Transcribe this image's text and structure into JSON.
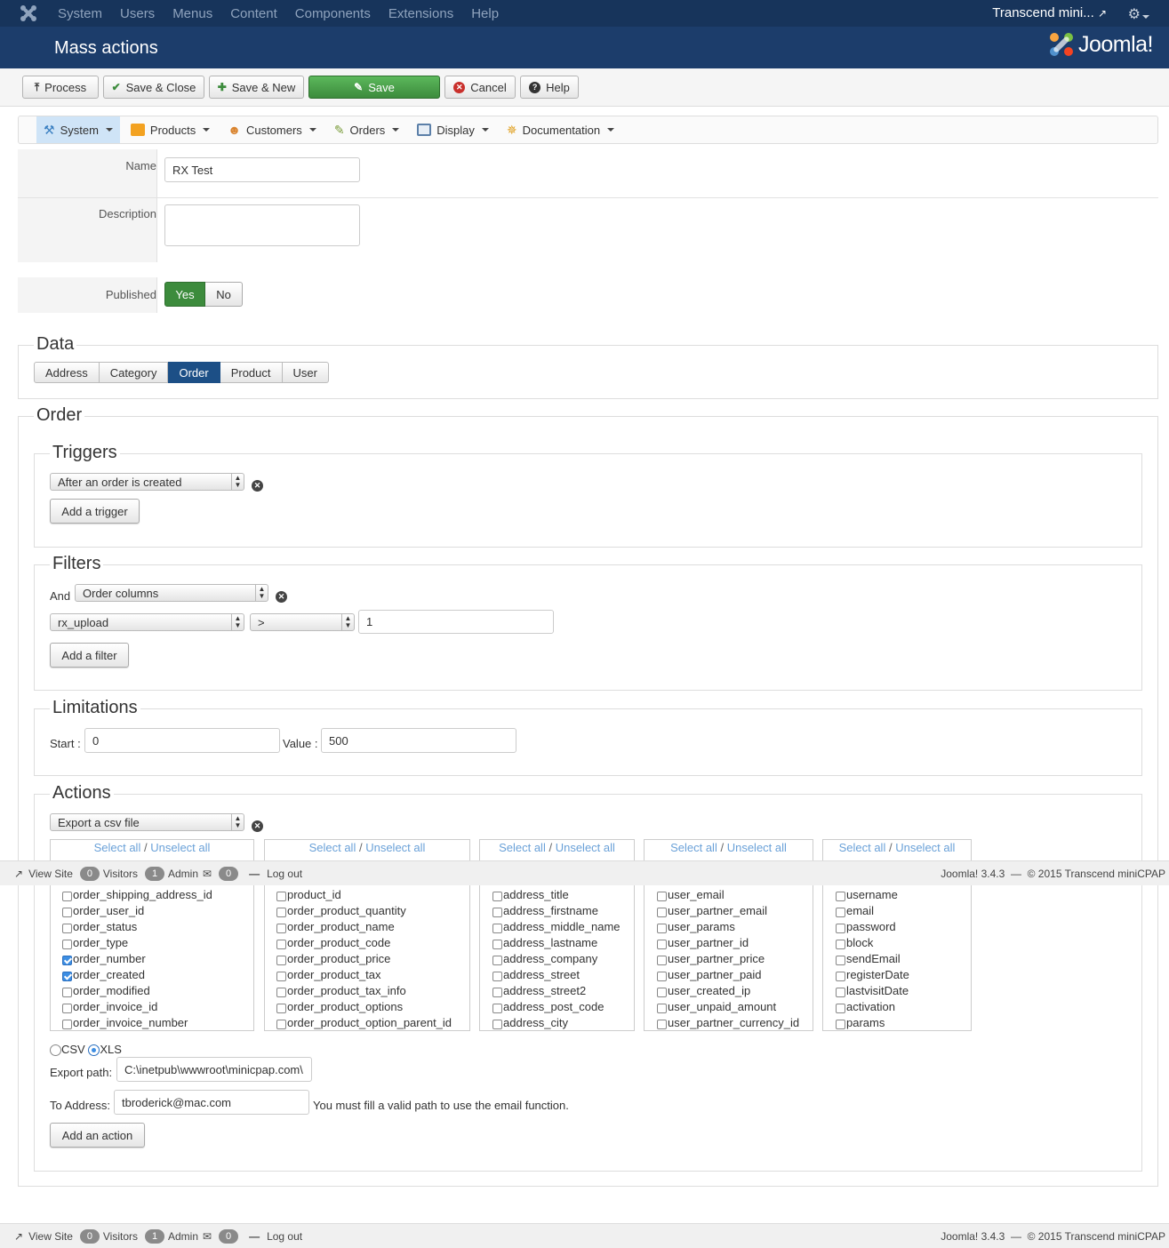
{
  "topnav": {
    "menu": [
      "System",
      "Users",
      "Menus",
      "Content",
      "Components",
      "Extensions",
      "Help"
    ],
    "site_name": "Transcend mini...",
    "icons": [
      "joomla-icon",
      "external-link-icon",
      "gear-icon"
    ]
  },
  "header": {
    "title": "Mass actions",
    "brand": "Joomla!"
  },
  "toolbar": {
    "process": "Process",
    "save_close": "Save & Close",
    "save_new": "Save & New",
    "save": "Save",
    "cancel": "Cancel",
    "help": "Help"
  },
  "submenu": {
    "items": [
      "System",
      "Products",
      "Customers",
      "Orders",
      "Display",
      "Documentation"
    ]
  },
  "form": {
    "name_label": "Name",
    "name_value": "RX Test",
    "description_label": "Description",
    "description_value": "",
    "published_label": "Published",
    "yes": "Yes",
    "no": "No"
  },
  "data_section": {
    "legend": "Data",
    "tabs": [
      "Address",
      "Category",
      "Order",
      "Product",
      "User"
    ],
    "active_tab": "Order"
  },
  "order_section": {
    "legend": "Order",
    "triggers": {
      "legend": "Triggers",
      "selected": "After an order is created",
      "add_button": "Add a trigger"
    },
    "filters": {
      "legend": "Filters",
      "and_label": "And",
      "type_selected": "Order columns",
      "column_selected": "rx_upload",
      "operator_selected": ">",
      "value": "1",
      "add_button": "Add a filter"
    },
    "limitations": {
      "legend": "Limitations",
      "start_label": "Start :",
      "start_value": "0",
      "value_label": "Value :",
      "value_value": "500"
    },
    "actions": {
      "legend": "Actions",
      "selected": "Export a csv file",
      "select_all": "Select all",
      "separator": "/",
      "unselect_all": "Unselect all",
      "columns": [
        {
          "items": [
            {
              "label": "order_shipping_address_id",
              "checked": false
            },
            {
              "label": "order_user_id",
              "checked": false
            },
            {
              "label": "order_status",
              "checked": false
            },
            {
              "label": "order_type",
              "checked": false
            },
            {
              "label": "order_number",
              "checked": true
            },
            {
              "label": "order_created",
              "checked": true
            },
            {
              "label": "order_modified",
              "checked": false
            },
            {
              "label": "order_invoice_id",
              "checked": false
            },
            {
              "label": "order_invoice_number",
              "checked": false
            }
          ]
        },
        {
          "items": [
            {
              "label": "product_id",
              "checked": false
            },
            {
              "label": "order_product_quantity",
              "checked": false
            },
            {
              "label": "order_product_name",
              "checked": false
            },
            {
              "label": "order_product_code",
              "checked": false
            },
            {
              "label": "order_product_price",
              "checked": false
            },
            {
              "label": "order_product_tax",
              "checked": false
            },
            {
              "label": "order_product_tax_info",
              "checked": false
            },
            {
              "label": "order_product_options",
              "checked": false
            },
            {
              "label": "order_product_option_parent_id",
              "checked": false
            }
          ]
        },
        {
          "items": [
            {
              "label": "address_title",
              "checked": false
            },
            {
              "label": "address_firstname",
              "checked": false
            },
            {
              "label": "address_middle_name",
              "checked": false
            },
            {
              "label": "address_lastname",
              "checked": false
            },
            {
              "label": "address_company",
              "checked": false
            },
            {
              "label": "address_street",
              "checked": false
            },
            {
              "label": "address_street2",
              "checked": false
            },
            {
              "label": "address_post_code",
              "checked": false
            },
            {
              "label": "address_city",
              "checked": false
            }
          ]
        },
        {
          "items": [
            {
              "label": "user_email",
              "checked": false
            },
            {
              "label": "user_partner_email",
              "checked": false
            },
            {
              "label": "user_params",
              "checked": false
            },
            {
              "label": "user_partner_id",
              "checked": false
            },
            {
              "label": "user_partner_price",
              "checked": false
            },
            {
              "label": "user_partner_paid",
              "checked": false
            },
            {
              "label": "user_created_ip",
              "checked": false
            },
            {
              "label": "user_unpaid_amount",
              "checked": false
            },
            {
              "label": "user_partner_currency_id",
              "checked": false
            }
          ]
        },
        {
          "items": [
            {
              "label": "username",
              "checked": false
            },
            {
              "label": "email",
              "checked": false
            },
            {
              "label": "password",
              "checked": false
            },
            {
              "label": "block",
              "checked": false
            },
            {
              "label": "sendEmail",
              "checked": false
            },
            {
              "label": "registerDate",
              "checked": false
            },
            {
              "label": "lastvisitDate",
              "checked": false
            },
            {
              "label": "activation",
              "checked": false
            },
            {
              "label": "params",
              "checked": false
            }
          ]
        }
      ],
      "format_csv": "CSV",
      "format_xls": "XLS",
      "format_selected": "XLS",
      "export_path_label": "Export path:",
      "export_path_value": "C:\\inetpub\\wwwroot\\minicpap.com\\",
      "to_address_label": "To Address:",
      "to_address_value": "tbroderick@mac.com",
      "email_note": "You must fill a valid path to use the email function.",
      "add_button": "Add an action"
    }
  },
  "statusbar": {
    "view_site": "View Site",
    "visitors_count": "0",
    "visitors": "Visitors",
    "admin_count": "1",
    "admin": "Admin",
    "messages_count": "0",
    "logout": "Log out",
    "version": "Joomla! 3.4.3",
    "dash": "—",
    "copyright": "© 2015 Transcend miniCPAP"
  },
  "colors": {
    "topnav": "#17345b",
    "header": "#1c3d6b",
    "green": "#3c8b3c",
    "active_tab": "#1c4f86",
    "link": "#6aa1d8"
  }
}
